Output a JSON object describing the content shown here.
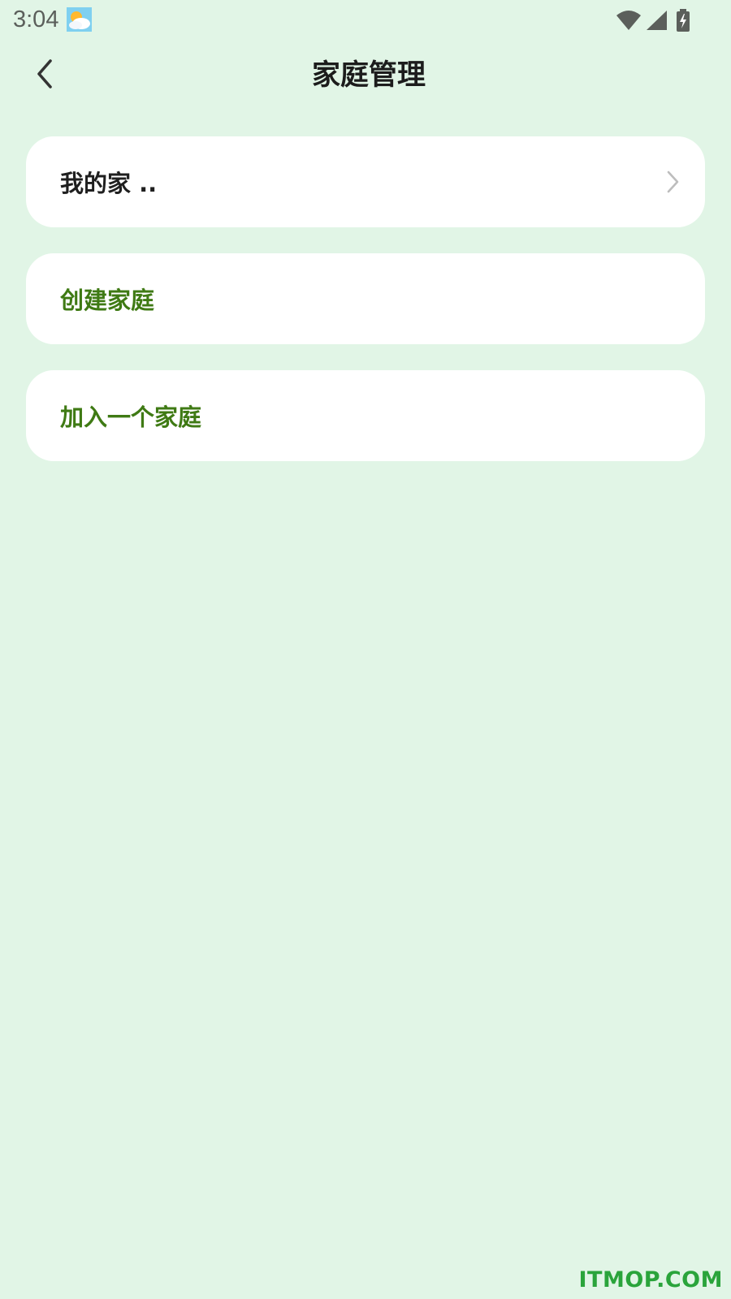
{
  "status_bar": {
    "time": "3:04",
    "icons": [
      "weather-icon",
      "wifi-icon",
      "signal-icon",
      "battery-charging-icon"
    ]
  },
  "header": {
    "title": "家庭管理",
    "back_icon": "chevron-left-icon"
  },
  "menu": {
    "my_home": "我的家 ..",
    "create_home": "创建家庭",
    "join_home": "加入一个家庭"
  },
  "watermark": "ITMOP.COM",
  "colors": {
    "background": "#e1f5e6",
    "card": "#ffffff",
    "accent_green": "#3f7a14",
    "text_dark": "#1f1f1f",
    "watermark_green": "#2aa43b"
  }
}
